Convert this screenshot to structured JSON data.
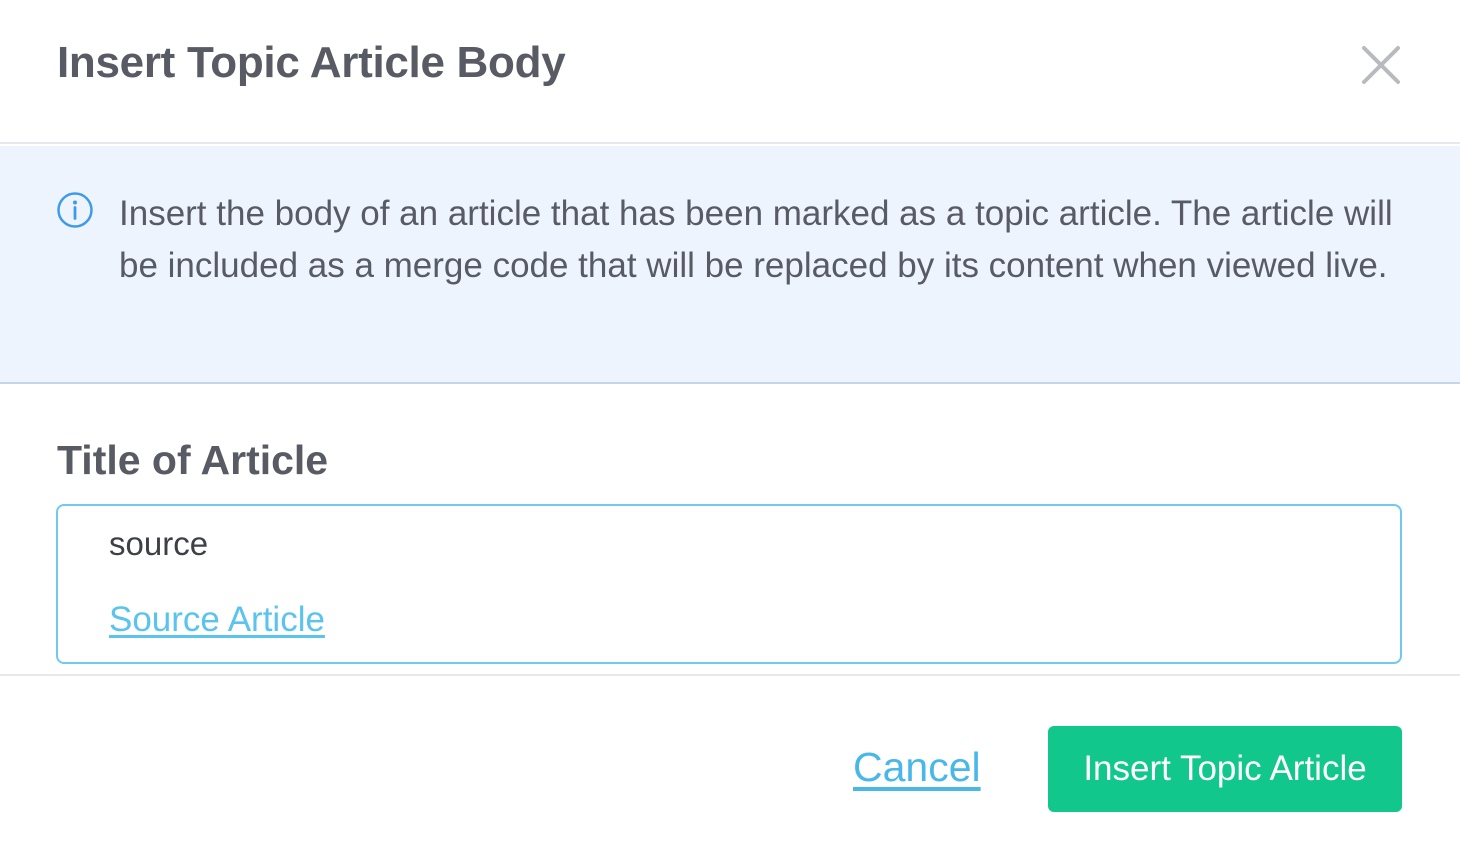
{
  "dialog": {
    "title": "Insert Topic Article Body",
    "close_icon": "close-icon"
  },
  "info": {
    "icon": "info-icon",
    "text": "Insert the body of an article that has been marked as a topic article. The article will be included as a merge code that will be replaced by its content when viewed live."
  },
  "field": {
    "label": "Title of Article",
    "value": "source",
    "suggestion": "Source Article"
  },
  "footer": {
    "cancel_label": "Cancel",
    "insert_label": "Insert Topic Article"
  },
  "colors": {
    "info_background": "#edf4fd",
    "accent_link": "#5ac3ee",
    "primary_button": "#12c78b",
    "text": "#585a64"
  }
}
